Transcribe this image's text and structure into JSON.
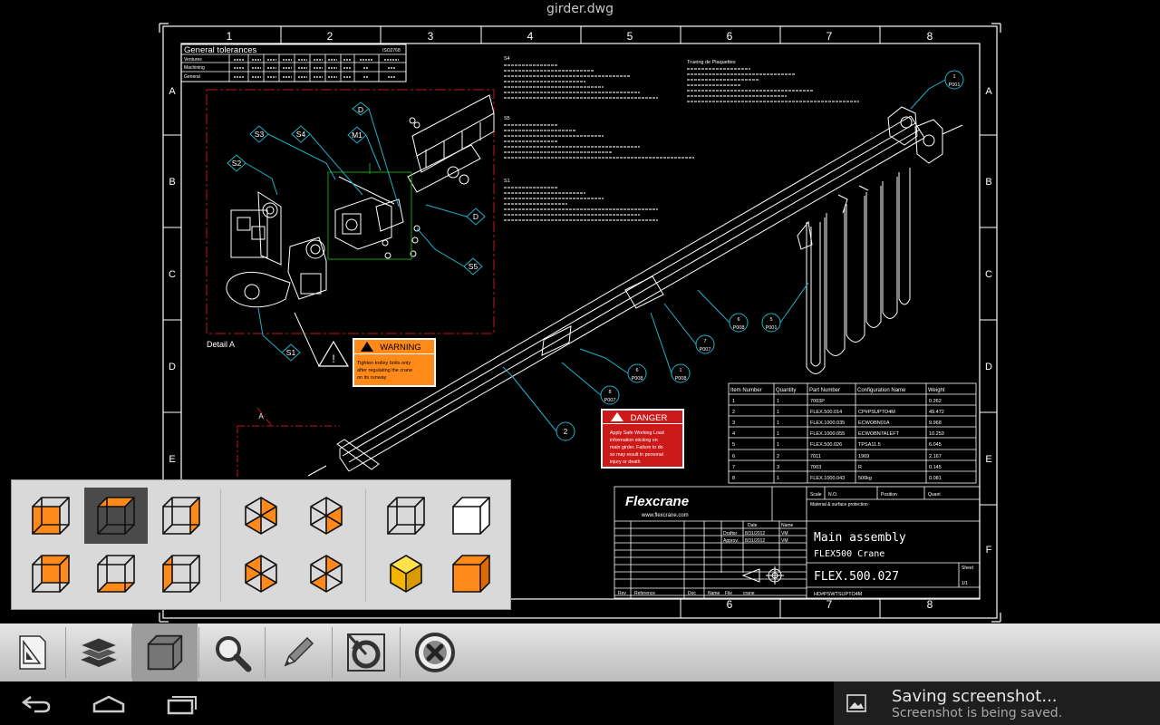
{
  "app": {
    "document_title": "girder.dwg"
  },
  "sheet": {
    "columns": [
      "1",
      "2",
      "3",
      "4",
      "5",
      "6",
      "7",
      "8"
    ],
    "rows": [
      "A",
      "B",
      "C",
      "D",
      "E",
      "F"
    ],
    "bottom_columns": [
      "6",
      "7",
      "8"
    ]
  },
  "tolerance_table": {
    "title": "General tolerances",
    "code": "ISO2768",
    "rows": [
      "Ventures",
      "Machining",
      "General"
    ]
  },
  "detail": {
    "label": "Detail A",
    "callouts": [
      "D",
      "S3",
      "S4",
      "M1",
      "S2",
      "D",
      "S5",
      "S1"
    ]
  },
  "notes": {
    "block1_title": "S4",
    "block2_title": "S5",
    "block3_title": "S1",
    "block4_title": "Trueing de Plaquettes"
  },
  "warning": {
    "label": "WARNING",
    "text": [
      "Tighten trolley bolts only",
      "after regulating the crane",
      "on its runway"
    ]
  },
  "danger": {
    "label": "DANGER",
    "text": [
      "Apply Safe Working Load",
      "information sticking on",
      "main girder. Failure to do",
      "so may result in personal",
      "injury or death"
    ]
  },
  "balloons": [
    "P001",
    "P008",
    "P001",
    "P007",
    "P008",
    "P008",
    "P007",
    "2",
    "A"
  ],
  "balloon_numbers": [
    "1",
    "6",
    "5",
    "7",
    "6",
    "1",
    "8",
    "2",
    "A"
  ],
  "bom": {
    "headers": [
      "Item Number",
      "Quantity",
      "Part Number",
      "Configuration Name",
      "Weight"
    ],
    "rows": [
      [
        "1",
        "1",
        "7003P",
        "",
        "0.262"
      ],
      [
        "2",
        "1",
        "FLEX.500.014",
        "CP#PSUPTO4M",
        "49.472"
      ],
      [
        "3",
        "1",
        "FLEX.1000.035",
        "ECWOBN01A",
        "9.968"
      ],
      [
        "4",
        "1",
        "FLEX.1000.055",
        "ECWOBN7ALEFT",
        "10.253"
      ],
      [
        "5",
        "1",
        "FLEX.500.026",
        "TPSA11.5",
        "6.045"
      ],
      [
        "6",
        "2",
        "7011",
        "1969",
        "2.167"
      ],
      [
        "7",
        "3",
        "7003",
        "R",
        "0.145"
      ],
      [
        "8",
        "1",
        "FLEX.1000.043",
        "500kg",
        "0.081"
      ]
    ]
  },
  "title_block": {
    "brand": "Flexcrane",
    "url": "www.flexcrane.com",
    "scale_label": "Scale",
    "scale_value": "N.O.",
    "position_label": "Position",
    "quant_label": "Quant",
    "material_label": "Material & surface protection",
    "date_label": "Date",
    "name_label": "Name",
    "drawn_label": "Drafter",
    "drawn_date": "8/31/2012",
    "drawn_name": "VM",
    "approved_label": "Approv.",
    "approved_date": "8/31/2012",
    "approved_name": "VM",
    "main_title": "Main assembly",
    "sub_title": "FLEX500 Crane",
    "drawing_number": "FLEX.500.027",
    "config": "HD#PSWTSUPTO4M",
    "sheet_label": "Sheet",
    "sheet_value": "1/1",
    "rev_label": "Rev",
    "ref_label": "Reference",
    "doc_label": "Doc",
    "name2_label": "Name",
    "file_label": "File",
    "file_value": "crane"
  },
  "view_cube_panel": {
    "options": [
      "Front",
      "Top",
      "Right",
      "Isometric NE",
      "Isometric NW",
      "Wireframe",
      "Back",
      "Bottom",
      "Left",
      "Isometric SE",
      "Isometric SW",
      "Shaded",
      "Realistic"
    ]
  },
  "toolbar": {
    "buttons": [
      "Layouts",
      "Layers",
      "3D Views",
      "Zoom",
      "Markup",
      "Orbit",
      "Close"
    ]
  },
  "navbar": {
    "buttons": [
      "Back",
      "Home",
      "Recent apps"
    ]
  },
  "notification": {
    "title": "Saving screenshot...",
    "subtitle": "Screenshot is being saved."
  },
  "colors": {
    "accent_orange": "#ff8a1a",
    "danger_red": "#cc1a1a",
    "cyan_lines": "#1fb0c8",
    "red_dashes": "#c01818",
    "green_lines": "#18a018"
  }
}
